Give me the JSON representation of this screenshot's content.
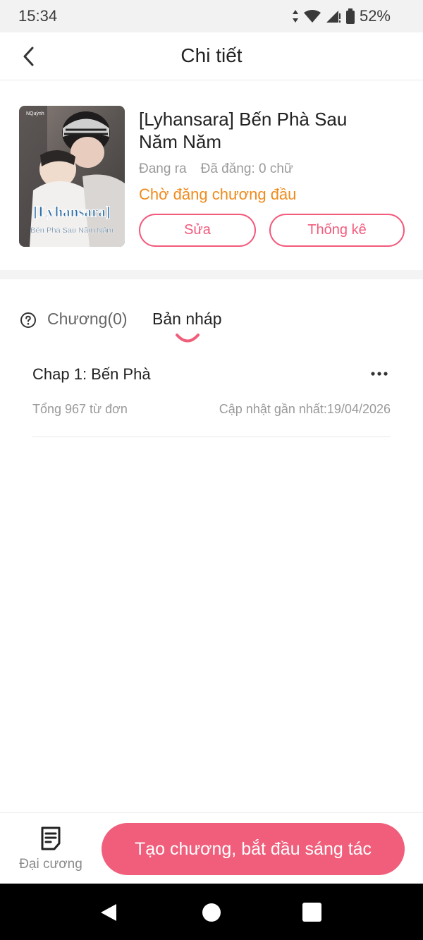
{
  "status_bar": {
    "time": "15:34",
    "battery": "52%"
  },
  "header": {
    "title": "Chi tiết",
    "back_icon": "chevron-left-icon"
  },
  "book": {
    "title": "[Lyhansara] Bến Phà Sau Năm Năm",
    "state": "Đang ra",
    "published": "Đã đăng: 0 chữ",
    "status": "Chờ đăng chương đầu",
    "status_color": "#f08a1c",
    "edit_label": "Sửa",
    "stats_label": "Thống kê",
    "cover": {
      "author_tag": "NQuỳnh",
      "title_text": "[Lyhansara]",
      "subtitle_text": "Bến Phà Sau Năm Năm"
    }
  },
  "tabs": {
    "help_icon": "question-circle-icon",
    "chapters_label": "Chương(0)",
    "drafts_label": "Bản nháp",
    "active": "drafts"
  },
  "drafts": [
    {
      "title": "Chap 1: Bến Phà",
      "words": "Tổng 967 từ đơn",
      "updated": "Cập nhật gần nhất:19/04/2026",
      "more_icon": "more-horizontal-icon"
    }
  ],
  "bottom_bar": {
    "outline_label": "Đại cương",
    "outline_icon": "document-list-icon",
    "create_label": "Tạo chương, bắt đầu sáng tác"
  },
  "colors": {
    "accent": "#f05e7b",
    "outline_accent": "#f25a7c",
    "warning": "#f08a1c"
  }
}
